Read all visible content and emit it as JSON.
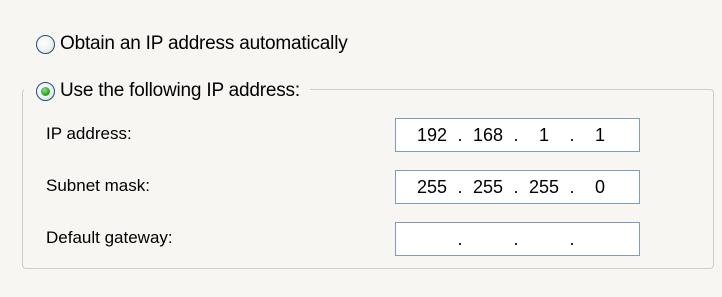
{
  "radio_options": {
    "auto": {
      "label": "Obtain an IP address automatically",
      "selected": false
    },
    "manual": {
      "label": "Use the following IP address:",
      "selected": true
    }
  },
  "fields": {
    "ip_address": {
      "label": "IP address:",
      "octets": [
        "192",
        "168",
        "1",
        "1"
      ]
    },
    "subnet_mask": {
      "label": "Subnet mask:",
      "octets": [
        "255",
        "255",
        "255",
        "0"
      ]
    },
    "default_gateway": {
      "label": "Default gateway:",
      "octets": [
        "",
        "",
        "",
        ""
      ]
    }
  },
  "separator": ".",
  "colors": {
    "background": "#f7f6f2",
    "selected_dot": "#33b033",
    "input_border": "#7f9db9",
    "group_border": "#d0d0bf"
  },
  "icons": {
    "radio_unselected": "radio-unselected-icon",
    "radio_selected": "radio-selected-icon"
  }
}
